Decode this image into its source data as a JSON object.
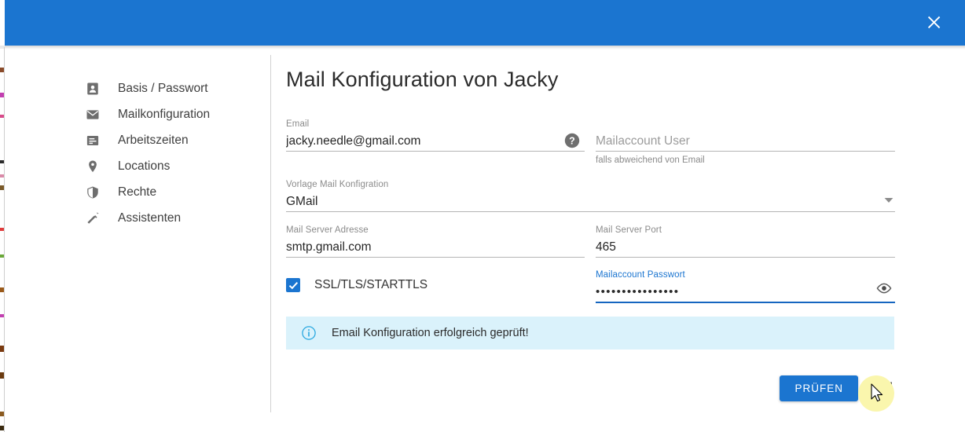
{
  "window": {
    "header_color": "#1B75D0",
    "close_label": "×",
    "close_icon": "close-icon"
  },
  "sidebar": {
    "items": [
      {
        "label": "Basis / Passwort",
        "icon": "person-badge-icon",
        "selected": false
      },
      {
        "label": "Mailkonfiguration",
        "icon": "envelope-icon",
        "selected": true
      },
      {
        "label": "Arbeitszeiten",
        "icon": "timesheet-icon",
        "selected": false
      },
      {
        "label": "Locations",
        "icon": "location-pin-icon",
        "selected": false
      },
      {
        "label": "Rechte",
        "icon": "shield-icon",
        "selected": false
      },
      {
        "label": "Assistenten",
        "icon": "magic-wand-icon",
        "selected": false
      }
    ]
  },
  "main": {
    "title": "Mail Konfiguration von Jacky",
    "fields": {
      "email": {
        "label": "Email",
        "value": "jacky.needle@gmail.com",
        "help_icon": "help-circle-icon"
      },
      "mailaccount_user": {
        "label": "",
        "placeholder": "Mailaccount User",
        "value": "",
        "hint": "falls abweichend von Email"
      },
      "vorlage": {
        "label": "Vorlage Mail Konfigration",
        "value": "GMail",
        "dropdown_icon": "chevron-down-icon",
        "options": [
          "GMail"
        ]
      },
      "mail_server_adresse": {
        "label": "Mail Server Adresse",
        "value": "smtp.gmail.com"
      },
      "mail_server_port": {
        "label": "Mail Server Port",
        "value": "465"
      },
      "mailaccount_passwort": {
        "label": "Mailaccount Passwort",
        "value": "••••••••••••••••",
        "focused": true,
        "reveal_icon": "eye-icon",
        "accent": "#1565C0"
      }
    },
    "ssl_checkbox": {
      "label": "SSL/TLS/STARTTLS",
      "checked": true,
      "color": "#1B75D0"
    },
    "info_banner": {
      "icon": "info-circle-icon",
      "text": "Email Konfiguration erfolgreich geprüft!",
      "background": "#daf2fb",
      "icon_color": "#2aa8e0"
    },
    "actions": {
      "primary_label": "PRÜFEN",
      "primary_color": "#1B75D0",
      "reset_icon": "refresh-icon"
    }
  }
}
